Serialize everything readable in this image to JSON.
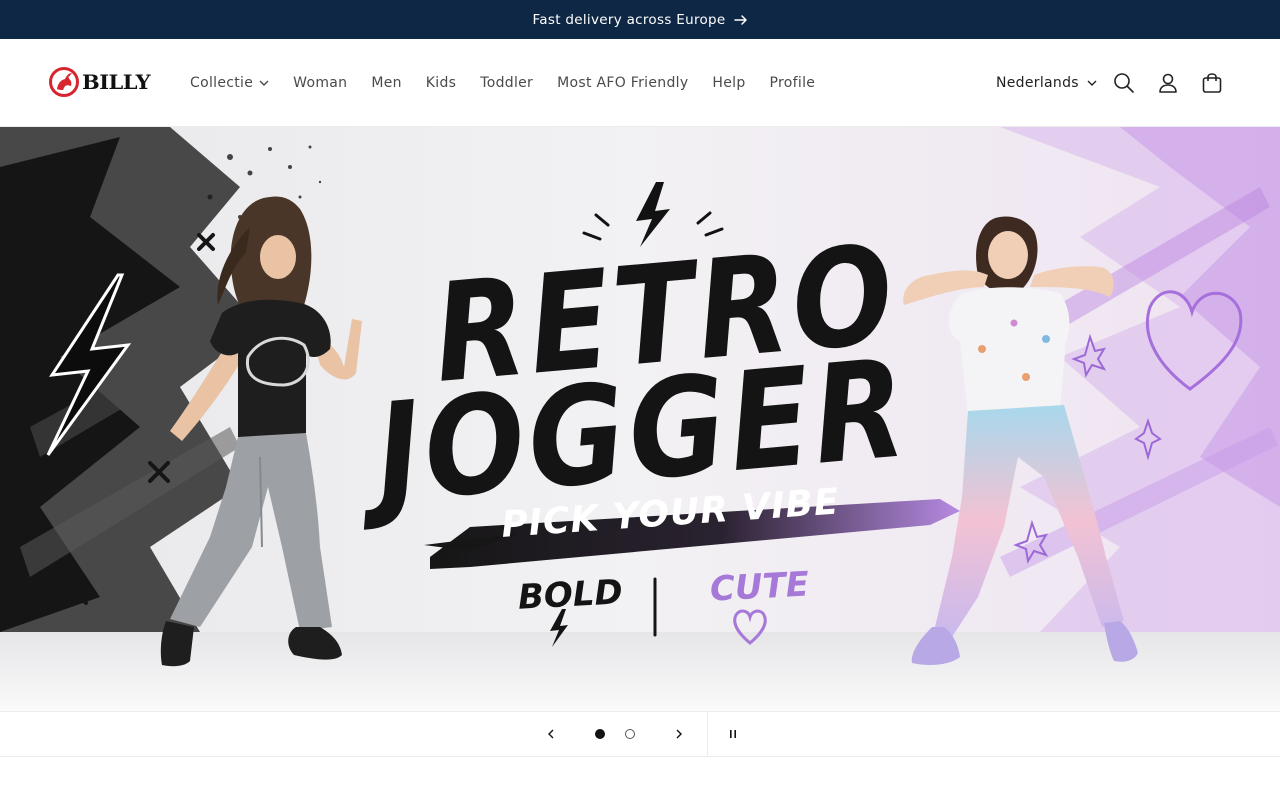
{
  "announcement": {
    "text": "Fast delivery across Europe"
  },
  "brand": {
    "name": "BILLY",
    "accent": "#d7252f"
  },
  "nav": {
    "items": [
      {
        "label": "Collectie",
        "has_dropdown": true
      },
      {
        "label": "Woman"
      },
      {
        "label": "Men"
      },
      {
        "label": "Kids"
      },
      {
        "label": "Toddler"
      },
      {
        "label": "Most AFO Friendly"
      },
      {
        "label": "Help"
      },
      {
        "label": "Profile"
      }
    ]
  },
  "language": {
    "selected": "Nederlands"
  },
  "hero": {
    "headline_line1": "RETRO",
    "headline_line2": "JOGGER",
    "tagline": "PICK YOUR VIBE",
    "option_bold": "BOLD",
    "option_cute": "CUTE",
    "bold_color": "#141414",
    "cute_color": "#a679d8"
  },
  "slider": {
    "current_slide": 1,
    "total_slides": 2
  },
  "colors": {
    "announcement_bg": "#0e2745",
    "header_bg": "#ffffff"
  }
}
